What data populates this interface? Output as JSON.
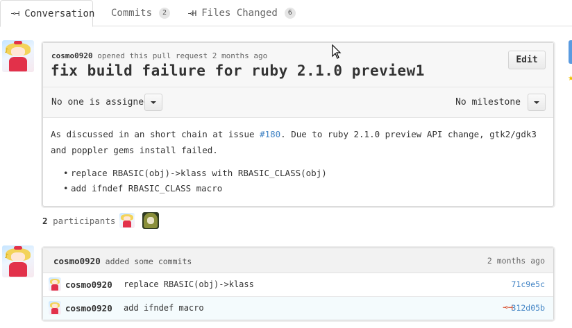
{
  "tabs": [
    {
      "label": "Conversation",
      "icon": "discussion-icon",
      "glyph": "⊸⊣",
      "active": true
    },
    {
      "label": "Commits",
      "count": "2",
      "active": false
    },
    {
      "label": "Files Changed",
      "icon": "diff-icon",
      "glyph": "⊸H",
      "count": "6",
      "active": false
    }
  ],
  "pull_request": {
    "author": "cosmo0920",
    "meta_text": "opened this pull request 2 months ago",
    "title": "fix build failure for ruby 2.1.0 preview1",
    "edit_label": "Edit",
    "assignee_text": "No one is assigned",
    "milestone_text": "No milestone",
    "body_before_link": "As discussed in an short chain at issue ",
    "issue_link": "#180",
    "body_after_link": ". Due to ruby 2.1.0 preview API change, gtk2/gdk3 and poppler gems install failed.",
    "bullets": [
      "replace RBASIC(obj)->klass with RBASIC_CLASS(obj)",
      "add ifndef RBASIC_CLASS macro"
    ]
  },
  "participants": {
    "count": "2",
    "label": "participants"
  },
  "commits_event": {
    "author": "cosmo0920",
    "action": "added some commits",
    "time": "2 months ago",
    "rows": [
      {
        "author": "cosmo0920",
        "message": "replace RBASIC(obj)->klass",
        "sha": "71c9e5c",
        "status_icon": ""
      },
      {
        "author": "cosmo0920",
        "message": "add ifndef macro",
        "sha": "312d05b",
        "status_icon": "⊸⊣"
      }
    ]
  },
  "colors": {
    "link": "#4183c4",
    "ci_fail": "#d6421e",
    "header_bg": "#f7f7f7"
  }
}
